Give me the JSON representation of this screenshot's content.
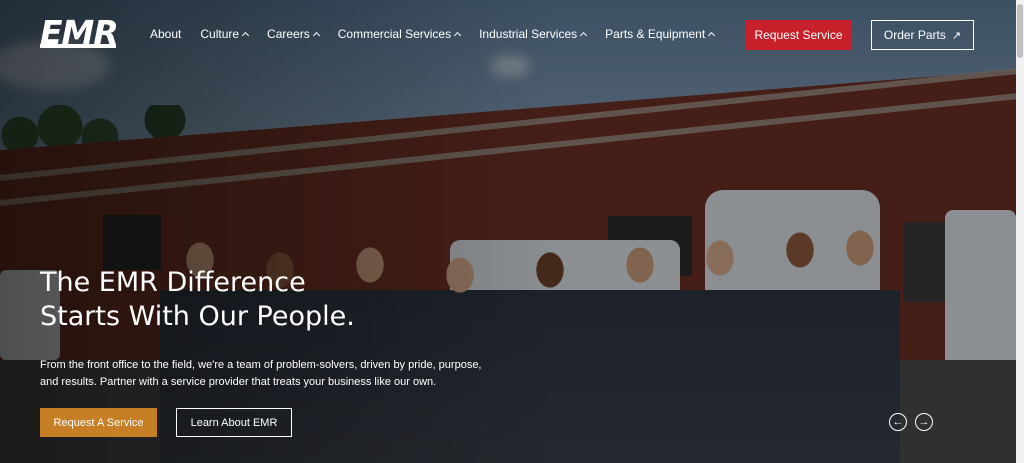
{
  "brand": {
    "logo_text": "EMR"
  },
  "nav": {
    "items": [
      {
        "label": "About",
        "has_dropdown": false
      },
      {
        "label": "Culture",
        "has_dropdown": true
      },
      {
        "label": "Careers",
        "has_dropdown": true
      },
      {
        "label": "Commercial Services",
        "has_dropdown": true
      },
      {
        "label": "Industrial Services",
        "has_dropdown": true
      },
      {
        "label": "Parts & Equipment",
        "has_dropdown": true
      }
    ],
    "request_service_label": "Request Service",
    "order_parts_label": "Order Parts",
    "colors": {
      "request_service_bg": "#c8202a"
    }
  },
  "hero": {
    "headline_line1": "The EMR Difference",
    "headline_line2": "Starts With Our People.",
    "subtext_line1": "From the front office to the field, we're a team of problem-solvers, driven by pride, purpose,",
    "subtext_line2": "and results. Partner with a service provider that treats your business like our own.",
    "primary_button": "Request A Service",
    "secondary_button": "Learn About EMR",
    "colors": {
      "primary_button_bg": "#c77f26"
    }
  },
  "slider": {
    "prev_icon": "arrow-left-icon",
    "next_icon": "arrow-right-icon"
  }
}
